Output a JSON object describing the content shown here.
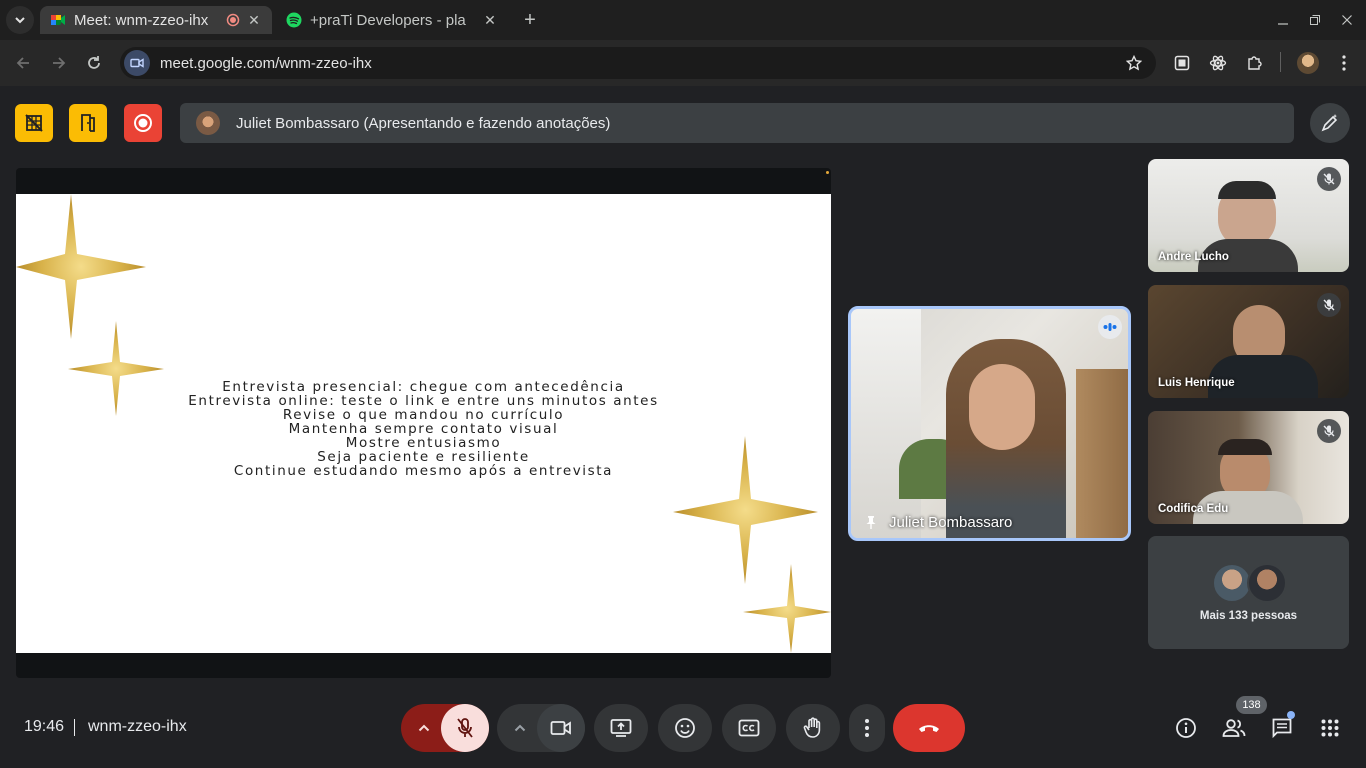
{
  "browser": {
    "tabs": [
      {
        "title": "Meet: wnm-zzeo-ihx",
        "active": true,
        "favicon": "google-meet-icon",
        "recording": true
      },
      {
        "title": "+praTi Developers - pla",
        "active": false,
        "favicon": "spotify-icon"
      }
    ],
    "url": "meet.google.com/wnm-zzeo-ihx"
  },
  "meeting": {
    "presenting_label": "Juliet Bombassaro (Apresentando e fazendo anotações)",
    "time": "19:46",
    "code": "wnm-zzeo-ihx",
    "participant_count": "138"
  },
  "slide": {
    "lines": [
      "Entrevista presencial: chegue com antecedência",
      "Entrevista online: teste o link e entre uns minutos antes",
      "Revise o que mandou no currículo",
      "Mantenha sempre contato visual",
      "Mostre entusiasmo",
      "Seja paciente e resiliente",
      "Continue estudando mesmo após a entrevista"
    ]
  },
  "participants": {
    "pinned": {
      "name": "Juliet Bombassaro"
    },
    "tiles": [
      {
        "name": "Andre Lucho"
      },
      {
        "name": "Luis Henrique"
      },
      {
        "name": "Codifica Edu"
      }
    ],
    "others_label": "Mais 133 pessoas"
  },
  "colors": {
    "meet_bg": "#202124",
    "host_yellow": "#fbbc04",
    "record_red": "#ea4335",
    "end_call_red": "#dc362e",
    "mic_off_bg": "#f9dedc",
    "mic_off_group": "#8c1d18",
    "pinned_border": "#a8c7fa"
  }
}
